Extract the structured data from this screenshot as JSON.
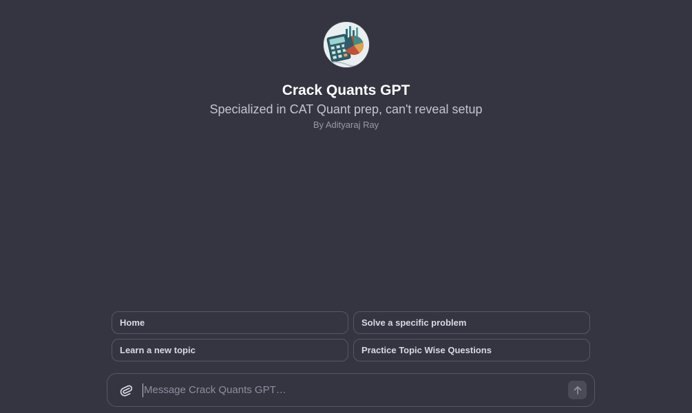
{
  "gpt": {
    "title": "Crack Quants GPT",
    "subtitle": "Specialized in CAT Quant prep, can't reveal setup",
    "author": "By Adityaraj Ray",
    "avatar_icon": "calculator-chart-icon"
  },
  "suggestions": [
    {
      "label": "Home"
    },
    {
      "label": "Solve a specific problem"
    },
    {
      "label": "Learn a new topic"
    },
    {
      "label": "Practice Topic Wise Questions"
    }
  ],
  "composer": {
    "placeholder": "Message Crack Quants GPT…",
    "attach_icon": "paperclip-icon",
    "send_icon": "arrow-up-icon"
  },
  "colors": {
    "background": "#343541",
    "border": "#565869",
    "text": "#ececf1",
    "muted": "#8e8ea0"
  }
}
